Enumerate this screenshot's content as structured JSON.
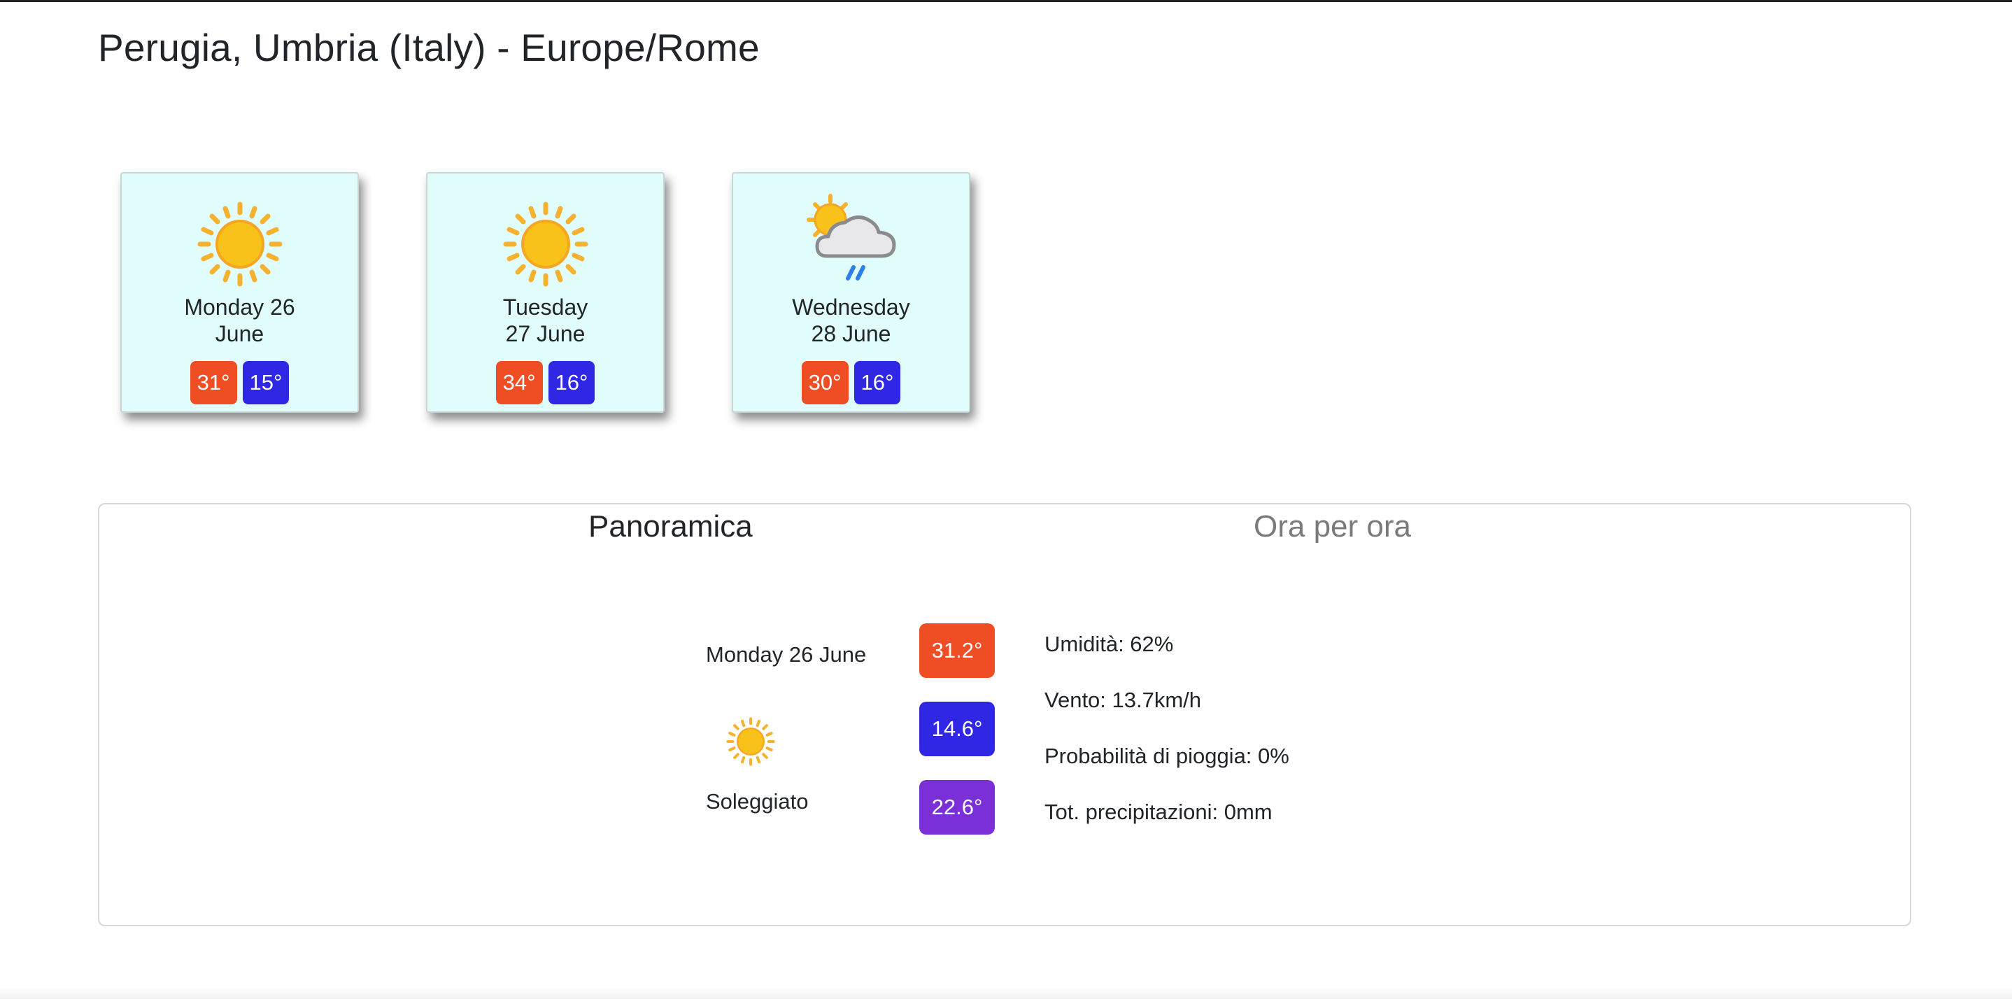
{
  "header": {
    "title": "Perugia, Umbria (Italy) - Europe/Rome"
  },
  "forecast": [
    {
      "day": "Monday 26",
      "month": "June",
      "max": "31°",
      "min": "15°",
      "icon": "sun-icon"
    },
    {
      "day": "Tuesday",
      "month": "27 June",
      "max": "34°",
      "min": "16°",
      "icon": "sun-icon"
    },
    {
      "day": "Wednesday",
      "month": "28 June",
      "max": "30°",
      "min": "16°",
      "icon": "sun-cloud-rain-icon"
    }
  ],
  "tabs": {
    "overview": "Panoramica",
    "hourly": "Ora per ora"
  },
  "overview": {
    "date": "Monday 26 June",
    "description": "Soleggiato",
    "icon": "sun-icon",
    "max": "31.2°",
    "min": "14.6°",
    "avg": "22.6°",
    "humidity": "Umidità: 62%",
    "wind": "Vento: 13.7km/h",
    "rain_probability": "Probabilità di pioggia: 0%",
    "precipitation": "Tot. precipitazioni: 0mm"
  },
  "colors": {
    "max": "#ef4d24",
    "min": "#2f27e3",
    "avg": "#7b2fd6",
    "card_bg": "#e0fdfc"
  }
}
